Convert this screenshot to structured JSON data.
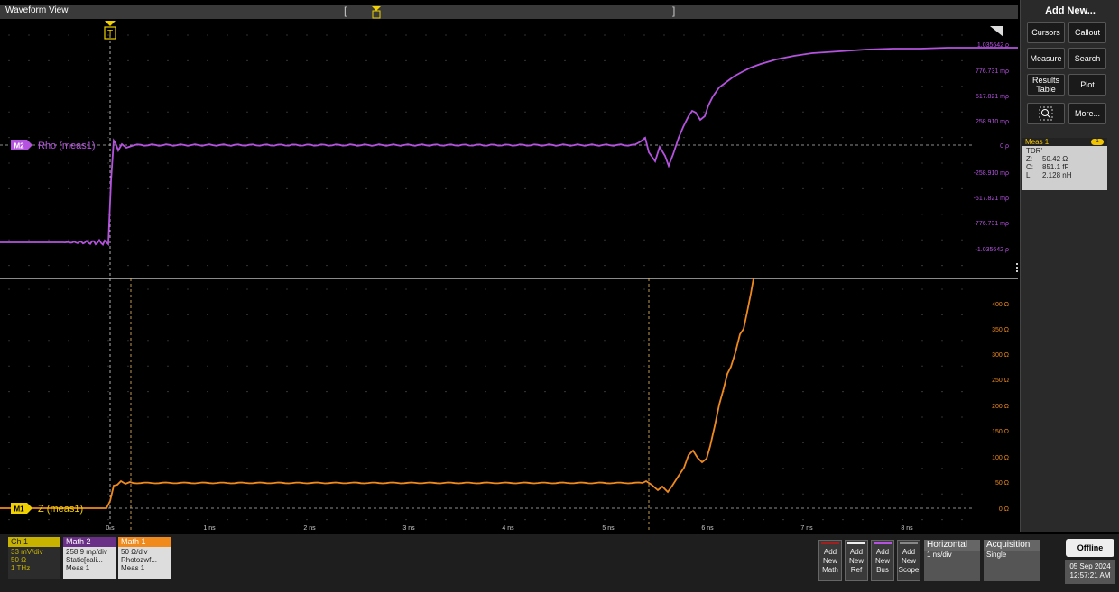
{
  "window": {
    "title": "Waveform View"
  },
  "right_panel": {
    "header": "Add New...",
    "buttons": {
      "cursors": "Cursors",
      "callout": "Callout",
      "measure": "Measure",
      "search": "Search",
      "results_table_1": "Results",
      "results_table_2": "Table",
      "plot": "Plot",
      "more": "More..."
    }
  },
  "meas_badge": {
    "title": "Meas 1",
    "count": "1",
    "name": "TDR'",
    "z_key": "Z:",
    "z_val": "50.42 Ω",
    "c_key": "C:",
    "c_val": "851.1 fF",
    "l_key": "L:",
    "l_val": "2.128 nH"
  },
  "upper": {
    "label_badge": "M2",
    "label": "Rho (meas1)",
    "scale_labels": [
      "1.035642 ρ",
      "776.731 mρ",
      "517.821 mρ",
      "258.910 mρ",
      "0 ρ",
      "-258.910 mρ",
      "-517.821 mρ",
      "-776.731 mρ",
      "-1.035642 ρ"
    ]
  },
  "lower": {
    "label_badge": "M1",
    "label": "Z (meas1)",
    "scale_labels": [
      "400 Ω",
      "350 Ω",
      "300 Ω",
      "250 Ω",
      "200 Ω",
      "150 Ω",
      "100 Ω",
      "50 Ω",
      "0 Ω"
    ]
  },
  "time_labels": [
    "0 s",
    "1 ns",
    "2 ns",
    "3 ns",
    "4 ns",
    "5 ns",
    "6 ns",
    "7 ns",
    "8 ns"
  ],
  "trigger": {
    "label": "T"
  },
  "channels": [
    {
      "name": "Ch 1",
      "l1": "33 mV/div",
      "l2": "50 Ω",
      "l3": "1 THz",
      "color": "#c8b400"
    },
    {
      "name": "Math 2",
      "l1": "258.9 mρ/div",
      "l2": "Static[cali...",
      "l3": "Meas 1",
      "color": "#a349c9"
    },
    {
      "name": "Math 1",
      "l1": "50 Ω/div",
      "l2": "Rhotozwf...",
      "l3": "Meas 1",
      "color": "#f08a1c"
    }
  ],
  "add_buttons": [
    {
      "l1": "Add",
      "l2": "New",
      "l3": "Math"
    },
    {
      "l1": "Add",
      "l2": "New",
      "l3": "Ref"
    },
    {
      "l1": "Add",
      "l2": "New",
      "l3": "Bus"
    },
    {
      "l1": "Add",
      "l2": "New",
      "l3": "Scope"
    }
  ],
  "horizontal": {
    "title": "Horizontal",
    "value": "1 ns/div"
  },
  "acquisition": {
    "title": "Acquisition",
    "value": "Single"
  },
  "status": {
    "offline": "Offline",
    "date": "05 Sep 2024",
    "time": "12:57:21 AM"
  },
  "colors": {
    "rho": "#b552e0",
    "z": "#f08a1c",
    "trigger": "#f0d000"
  }
}
